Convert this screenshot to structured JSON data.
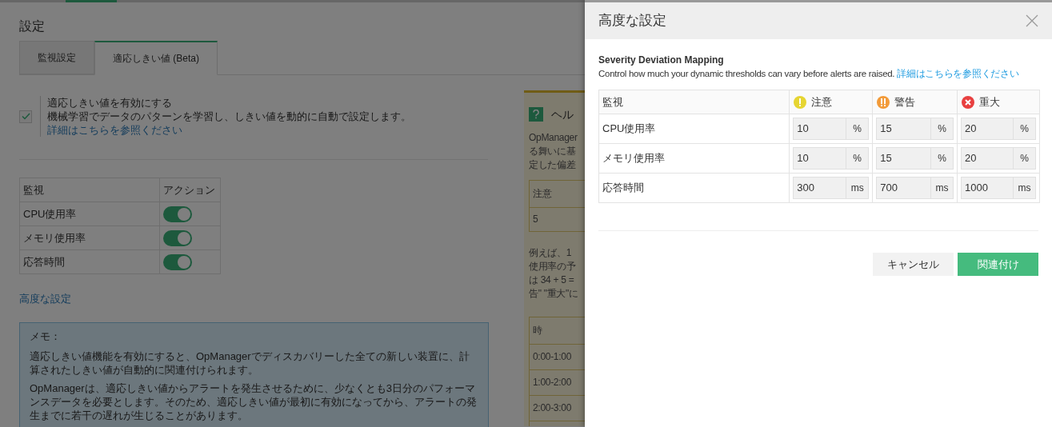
{
  "page": {
    "title": "設定",
    "tabs": [
      {
        "label": "監視設定",
        "selected": false
      },
      {
        "label": "適応しきい値 (Beta)",
        "selected": true
      }
    ],
    "enable": {
      "checked": true,
      "label": "適応しきい値を有効にする",
      "description": "機械学習でデータのパターンを学習し、しきい値を動的に自動で設定します。",
      "link": "詳細はこちらを参照ください"
    },
    "monitor_table": {
      "columns": [
        "監視",
        "アクション"
      ],
      "rows": [
        {
          "name": "CPU使用率",
          "on": true
        },
        {
          "name": "メモリ使用率",
          "on": true
        },
        {
          "name": "応答時間",
          "on": true
        }
      ]
    },
    "advanced_link": "高度な設定",
    "memo": {
      "title": "メモ：",
      "paragraphs": [
        "適応しきい値機能を有効にすると、OpManagerでディスカバリーした全ての新しい装置に、計算されたしきい値が自動的に関連付けられます。",
        "OpManagerは、適応しきい値からアラートを発生させるために、少なくとも3日分のパフォーマンスデータを必要とします。そのため、適応しきい値が最初に有効になってから、アラートの発生までに若干の遅れが生じることがあります。"
      ]
    },
    "help_panel": {
      "title": "ヘル",
      "intro_lines": [
        "OpManager",
        "る舞いに基",
        "定した偏差"
      ],
      "table_1": {
        "header": "注意",
        "value": "5"
      },
      "example_lines": [
        "例えば、1",
        "使用率の予",
        "は 34 + 5 =",
        "告\" \"重大\"に"
      ],
      "table_2": {
        "header": "時",
        "rows": [
          "0:00-1:00",
          "1:00-2:00",
          "2:00-3:00"
        ]
      }
    }
  },
  "dialog": {
    "title": "高度な設定",
    "heading": "Severity Deviation Mapping",
    "description": "Control how much your dynamic thresholds can vary before alerts are raised.",
    "link": "詳細はこちらを参照ください",
    "columns": [
      {
        "label": "監視",
        "kind": "plain"
      },
      {
        "label": "注意",
        "kind": "attention"
      },
      {
        "label": "警告",
        "kind": "warning"
      },
      {
        "label": "重大",
        "kind": "critical"
      }
    ],
    "rows": [
      {
        "name": "CPU使用率",
        "values": [
          {
            "value": "10",
            "unit": "%"
          },
          {
            "value": "15",
            "unit": "%"
          },
          {
            "value": "20",
            "unit": "%"
          }
        ]
      },
      {
        "name": "メモリ使用率",
        "values": [
          {
            "value": "10",
            "unit": "%"
          },
          {
            "value": "15",
            "unit": "%"
          },
          {
            "value": "20",
            "unit": "%"
          }
        ]
      },
      {
        "name": "応答時間",
        "values": [
          {
            "value": "300",
            "unit": "ms"
          },
          {
            "value": "700",
            "unit": "ms"
          },
          {
            "value": "1000",
            "unit": "ms"
          }
        ]
      }
    ],
    "buttons": [
      {
        "label": "キャンセル",
        "kind": "secondary"
      },
      {
        "label": "関連付け",
        "kind": "primary"
      }
    ]
  }
}
